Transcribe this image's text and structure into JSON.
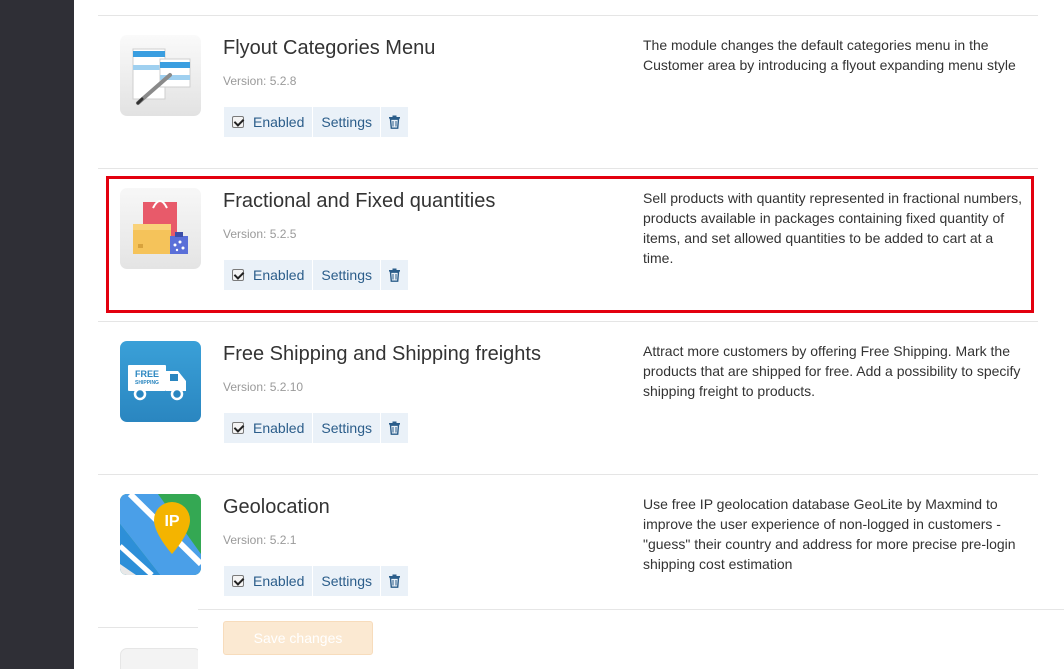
{
  "modules": [
    {
      "title": "Flyout Categories Menu",
      "version": "Version: 5.2.8",
      "enabled_label": "Enabled",
      "settings_label": "Settings",
      "description": "The module changes the default categories menu in the Customer area by introducing a flyout expanding menu style",
      "icon": "flyout-menu-icon"
    },
    {
      "title": "Fractional and Fixed quantities",
      "version": "Version: 5.2.5",
      "enabled_label": "Enabled",
      "settings_label": "Settings",
      "description": "Sell products with quantity represented in fractional numbers, products available in packages containing fixed quantity of items, and set allowed quantities to be added to cart at a time.",
      "icon": "shopping-boxes-icon"
    },
    {
      "title": "Free Shipping and Shipping freights",
      "version": "Version: 5.2.10",
      "enabled_label": "Enabled",
      "settings_label": "Settings",
      "description": "Attract more customers by offering Free Shipping. Mark the products that are shipped for free. Add a possibility to specify shipping freight to products.",
      "icon": "free-shipping-truck-icon",
      "icon_text_line1": "FREE",
      "icon_text_line2": "SHIPPING"
    },
    {
      "title": "Geolocation",
      "version": "Version: 5.2.1",
      "enabled_label": "Enabled",
      "settings_label": "Settings",
      "description": "Use free IP geolocation database GeoLite by Maxmind to improve the user experience of non-logged in customers - \"guess\" their country and address for more precise pre-login shipping cost estimation",
      "icon": "geolocation-map-icon",
      "icon_text": "IP"
    }
  ],
  "footer": {
    "save_label": "Save changes"
  },
  "colors": {
    "highlight": "#e3000f",
    "sidebar": "#2f2f36",
    "link": "#2b5d8a",
    "control_bg": "#eaf1f8",
    "save_disabled": "#fbe9d2"
  }
}
